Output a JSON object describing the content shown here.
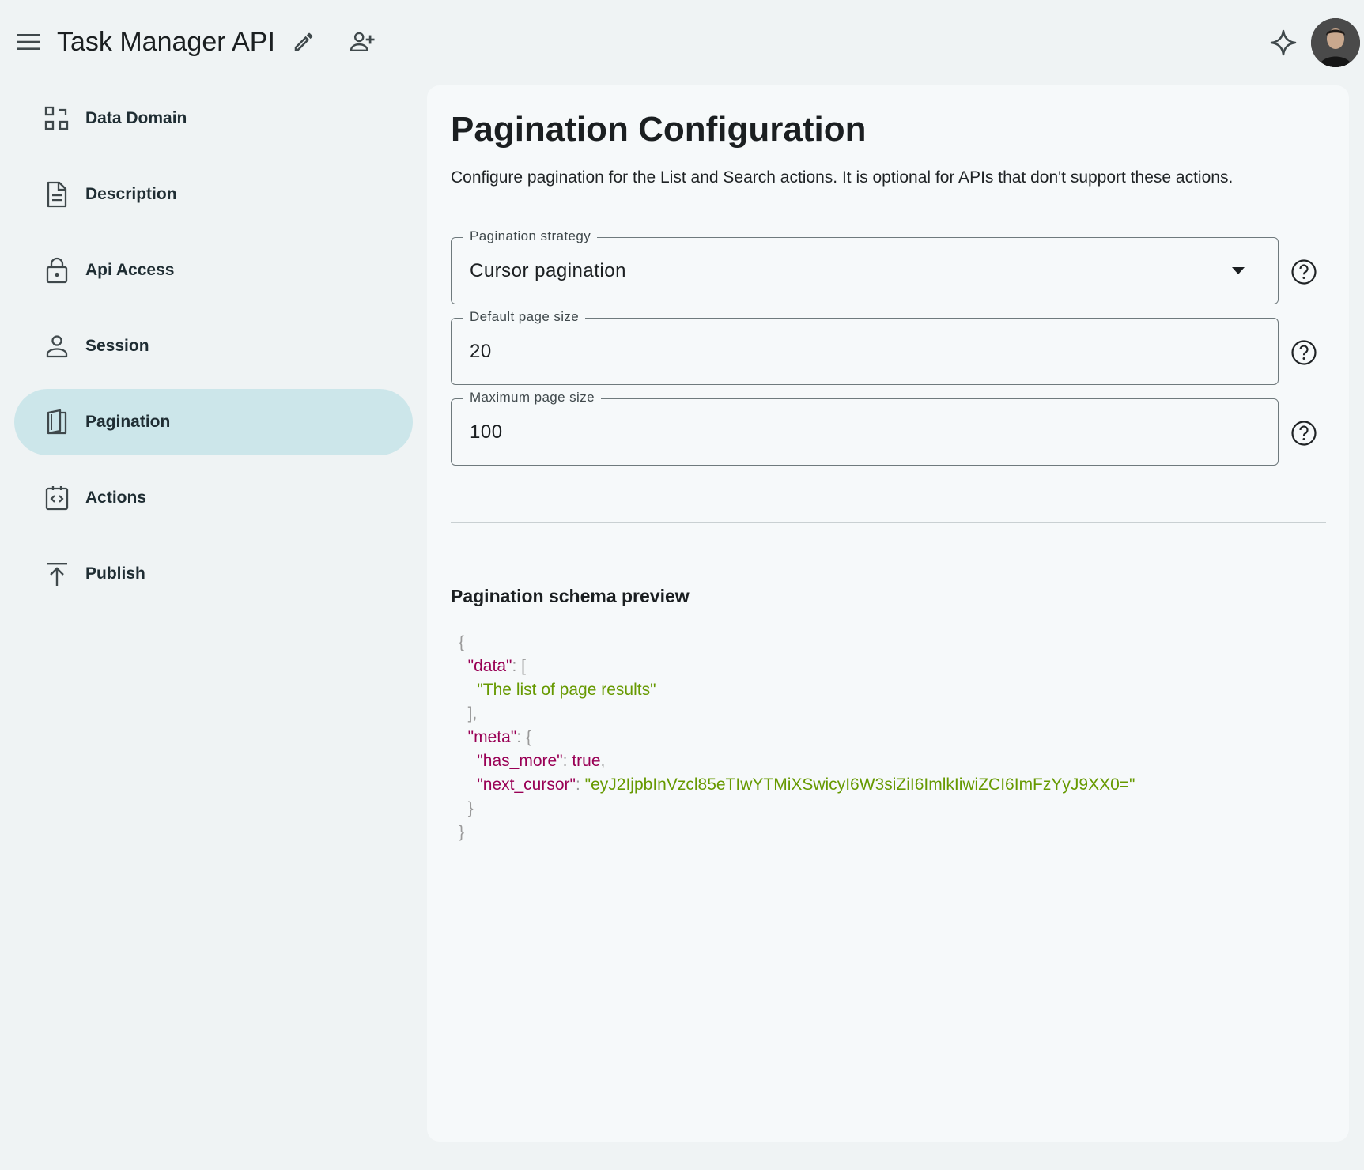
{
  "header": {
    "menu_icon": "hamburger-menu-icon",
    "title": "Task Manager API",
    "edit_icon": "pencil-icon",
    "share_icon": "person-add-icon",
    "assistant_icon": "sparkle-icon",
    "avatar_icon": "user-avatar"
  },
  "sidebar": {
    "items": [
      {
        "label": "Data Domain",
        "icon": "data-domain-icon",
        "active": false
      },
      {
        "label": "Description",
        "icon": "document-icon",
        "active": false
      },
      {
        "label": "Api Access",
        "icon": "lock-icon",
        "active": false
      },
      {
        "label": "Session",
        "icon": "person-icon",
        "active": false
      },
      {
        "label": "Pagination",
        "icon": "book-icon",
        "active": true
      },
      {
        "label": "Actions",
        "icon": "code-icon",
        "active": false
      },
      {
        "label": "Publish",
        "icon": "upload-icon",
        "active": false
      }
    ]
  },
  "main": {
    "title": "Pagination Configuration",
    "description": "Configure pagination for the List and Search actions. It is optional for APIs that don't support these actions.",
    "fields": {
      "strategy": {
        "label": "Pagination strategy",
        "value": "Cursor pagination"
      },
      "default_page_size": {
        "label": "Default page size",
        "value": "20"
      },
      "max_page_size": {
        "label": "Maximum page size",
        "value": "100"
      }
    },
    "preview": {
      "title": "Pagination schema preview",
      "open_brace": "{",
      "data_key": "\"data\"",
      "open_bracket": "[",
      "data_item": "\"The list of page results\"",
      "close_bracket": "],",
      "meta_key": "\"meta\"",
      "meta_open": "{",
      "has_more_key": "\"has_more\"",
      "has_more_value": "true",
      "next_cursor_key": "\"next_cursor\"",
      "next_cursor_value": "\"eyJ2IjpbInVzcl85eTIwYTMiXSwicyI6W3siZiI6ImlkIiwiZCI6ImFzYyJ9XX0=\"",
      "meta_close": "}",
      "close_brace": "}"
    }
  },
  "colors": {
    "background": "#eff3f4",
    "card": "#f6f9fa",
    "active_nav": "#cce6ea",
    "json_key": "#990055",
    "json_string": "#669900"
  }
}
